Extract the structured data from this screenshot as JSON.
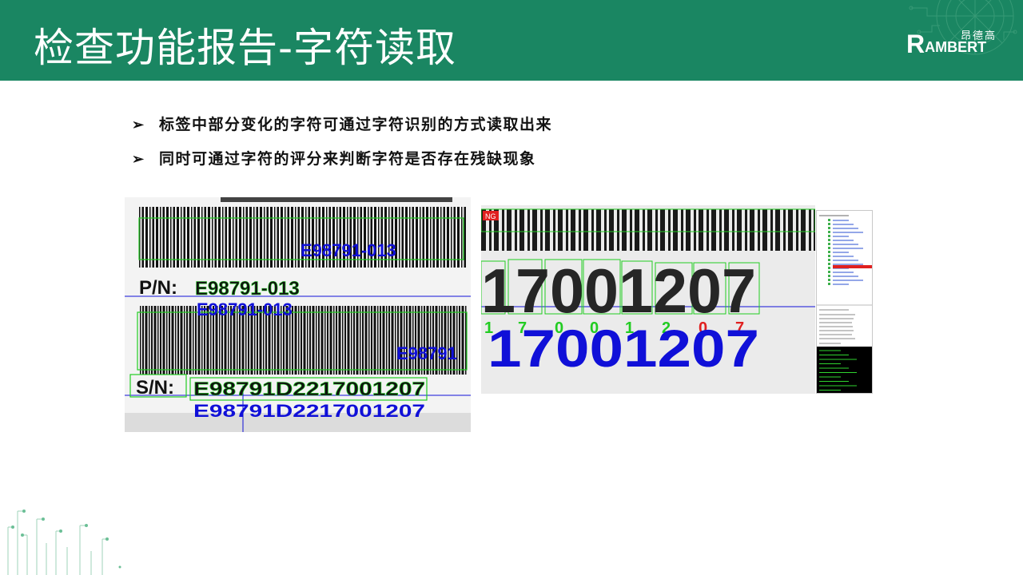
{
  "header": {
    "title": "检查功能报告-字符读取",
    "logo_cn": "昂德高",
    "logo_en_initial": "R",
    "logo_en_rest": "AMBERT"
  },
  "bullets": [
    "标签中部分变化的字符可通过字符识别的方式读取出来",
    "同时可通过字符的评分来判断字符是否存在残缺现象"
  ],
  "bullet_marker": "➢",
  "image1": {
    "pn_label": "P/N:",
    "pn_value": "E98791-013",
    "pn_read_top": "E98791-013",
    "pn_read": "E98791-013",
    "pn_read_right": "E98791",
    "sn_label": "S/N:",
    "sn_value": "E98791D2217001207",
    "sn_read": "E98791D2217001207"
  },
  "image2": {
    "ng_badge": "NG",
    "printed": "17001207",
    "read_chars": [
      "1",
      "7",
      "0",
      "0",
      "1",
      "2",
      "0",
      "7"
    ],
    "read_colors": [
      "#22cc22",
      "#22cc22",
      "#22cc22",
      "#22cc22",
      "#22cc22",
      "#22cc22",
      "#e02020",
      "#e02020"
    ],
    "result": "17001207"
  },
  "colors": {
    "header_bg": "#1a8662",
    "box_green": "#22cc22",
    "read_blue": "#1010d8",
    "ng_red": "#e02020"
  }
}
